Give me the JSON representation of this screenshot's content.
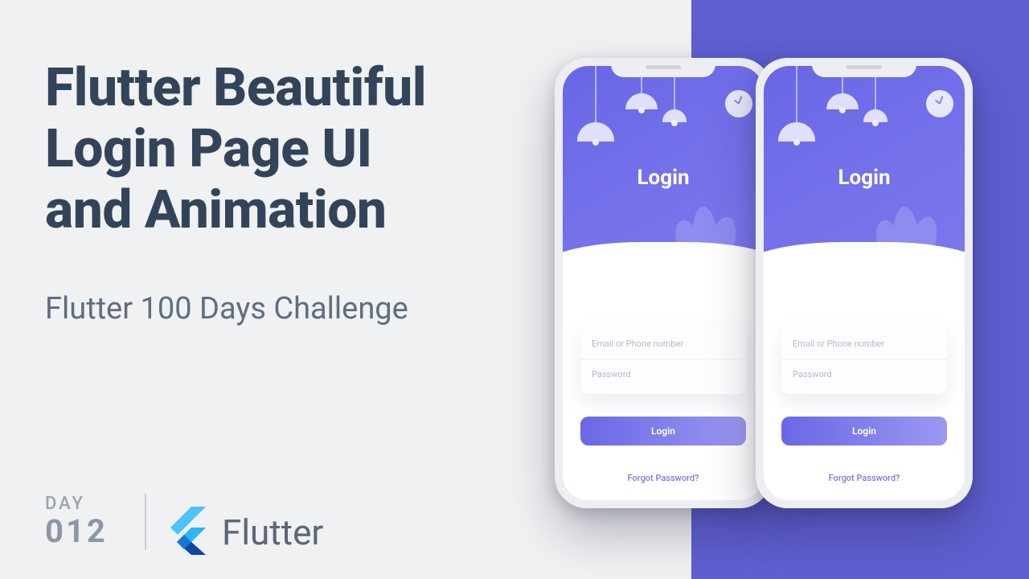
{
  "title_line1": "Flutter Beautiful",
  "title_line2": "Login Page UI",
  "title_line3": "and Animation",
  "subtitle": "Flutter 100 Days Challenge",
  "day_label": "DAY",
  "day_number": "012",
  "brand": "Flutter",
  "phone": {
    "heading": "Login",
    "email_placeholder": "Email or Phone number",
    "password_placeholder": "Password",
    "button": "Login",
    "forgot": "Forgot Password?"
  },
  "colors": {
    "accent": "#6a67e6",
    "bg_right": "#5f5fd1",
    "text_dark": "#33445a"
  }
}
